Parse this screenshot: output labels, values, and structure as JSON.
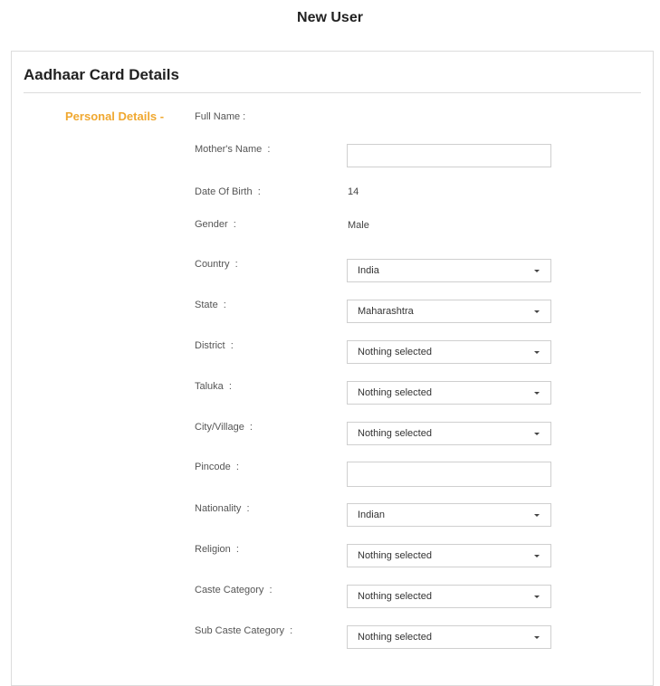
{
  "page": {
    "title": "New User"
  },
  "card": {
    "title": "Aadhaar Card Details",
    "section_label": "Personal Details -"
  },
  "fields": {
    "full_name": {
      "label": "Full Name :",
      "value": ""
    },
    "mothers_name": {
      "label": "Mother's Name  :",
      "value": ""
    },
    "dob": {
      "label": "Date Of Birth  :",
      "value": "14"
    },
    "gender": {
      "label": "Gender  :",
      "value": "Male"
    },
    "country": {
      "label": "Country  :",
      "value": "India"
    },
    "state": {
      "label": "State  :",
      "value": "Maharashtra"
    },
    "district": {
      "label": "District  :",
      "value": "Nothing selected"
    },
    "taluka": {
      "label": "Taluka  :",
      "value": "Nothing selected"
    },
    "city": {
      "label": "City/Village  :",
      "value": "Nothing selected"
    },
    "pincode": {
      "label": "Pincode  :",
      "value": ""
    },
    "nationality": {
      "label": "Nationality  :",
      "value": "Indian"
    },
    "religion": {
      "label": "Religion  :",
      "value": "Nothing selected"
    },
    "caste": {
      "label": "Caste Category  :",
      "value": "Nothing selected"
    },
    "subcaste": {
      "label": "Sub Caste Category  :",
      "value": "Nothing selected"
    }
  }
}
